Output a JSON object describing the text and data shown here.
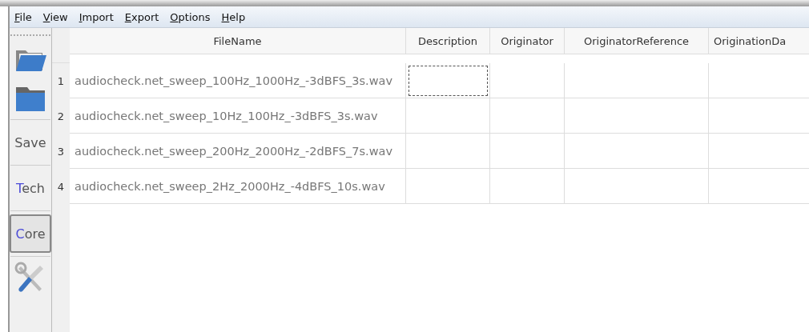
{
  "menu": [
    "File",
    "View",
    "Import",
    "Export",
    "Options",
    "Help"
  ],
  "toolbar": [
    {
      "kind": "open-folder"
    },
    {
      "kind": "folder"
    },
    {
      "kind": "text",
      "label": "Save",
      "selected": false
    },
    {
      "kind": "text",
      "label": "Tech",
      "selected": false
    },
    {
      "kind": "text",
      "label": "Core",
      "selected": true
    },
    {
      "kind": "tools"
    }
  ],
  "table": {
    "columns": [
      "FileName",
      "Description",
      "Originator",
      "OriginatorReference",
      "OriginationDa"
    ],
    "rows": [
      {
        "number": "1",
        "filename": "audiocheck.net_sweep_100Hz_1000Hz_-3dBFS_3s.wav",
        "description_focused": true
      },
      {
        "number": "2",
        "filename": "audiocheck.net_sweep_10Hz_100Hz_-3dBFS_3s.wav",
        "description_focused": false
      },
      {
        "number": "3",
        "filename": "audiocheck.net_sweep_200Hz_2000Hz_-2dBFS_7s.wav",
        "description_focused": false
      },
      {
        "number": "4",
        "filename": "audiocheck.net_sweep_2Hz_2000Hz_-4dBFS_10s.wav",
        "description_focused": false
      }
    ]
  }
}
